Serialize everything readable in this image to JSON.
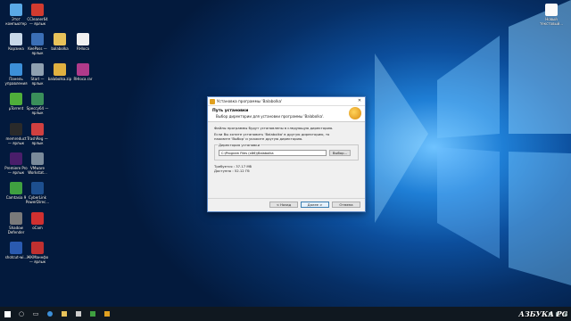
{
  "desktop_icons": [
    {
      "label": "Этот\nкомпьютер",
      "icon": "computer-icon",
      "color": "#5aa9e6"
    },
    {
      "label": "CCleaner64\n— ярлык",
      "icon": "ccleaner-icon",
      "color": "#d23b2f"
    },
    {
      "label": "Корзина",
      "icon": "recycle-bin-icon",
      "color": "#c8d8e8"
    },
    {
      "label": "KeePass —\nярлык",
      "icon": "keepass-icon",
      "color": "#3b6fb6"
    },
    {
      "label": "balabolka",
      "icon": "folder-icon",
      "color": "#e8c25a"
    },
    {
      "label": "RHloca",
      "icon": "file-icon",
      "color": "#f0f0f0"
    },
    {
      "label": "Панель\nуправления",
      "icon": "control-panel-icon",
      "color": "#3c8fd8"
    },
    {
      "label": "Start —\nярлык",
      "icon": "start-icon",
      "color": "#8fa0b0"
    },
    {
      "label": "balabolka.zip",
      "icon": "zip-icon",
      "color": "#e0b040"
    },
    {
      "label": "RHloca.rar",
      "icon": "rar-icon",
      "color": "#b03a8a"
    },
    {
      "label": "µTorrent",
      "icon": "utorrent-icon",
      "color": "#4fae3a"
    },
    {
      "label": "Speccy64 —\nярлык",
      "icon": "speccy-icon",
      "color": "#3a8f5a"
    },
    {
      "label": "memreduct\n— ярлык",
      "icon": "memreduct-icon",
      "color": "#2a2a2a"
    },
    {
      "label": "TrashReg —\nярлык",
      "icon": "trashreg-icon",
      "color": "#d04040"
    },
    {
      "label": "Premiere Pro\n— ярлык",
      "icon": "premiere-icon",
      "color": "#4a1e6a"
    },
    {
      "label": "VMware\nWorkstat...",
      "icon": "vmware-icon",
      "color": "#7a8a9a"
    },
    {
      "label": "Camtasia 9",
      "icon": "camtasia-icon",
      "color": "#3fa040"
    },
    {
      "label": "CyberLink\nPowerDirec...",
      "icon": "powerdirector-icon",
      "color": "#1d4f8f"
    },
    {
      "label": "Shadow\nDefender",
      "icon": "shadow-defender-icon",
      "color": "#7a7a7a"
    },
    {
      "label": "oCam",
      "icon": "ocam-icon",
      "color": "#d03030"
    },
    {
      "label": "shotcut-wi...",
      "icon": "shotcut-icon",
      "color": "#2a5ab0"
    },
    {
      "label": "ЖКМаннфо\n— ярлык",
      "icon": "app-icon",
      "color": "#c03030"
    }
  ],
  "desktop_right_icon": {
    "label": "Новый\nтекстовый...",
    "icon": "text-file-icon"
  },
  "dialog": {
    "title": "Установка программы 'Balabolka'",
    "header_title": "Путь установки",
    "header_subtitle": "Выбор директории для установки программы 'Balabolka'.",
    "line1": "Файлы программы будут установлены в следующую директорию.",
    "line2": "Если Вы хотите установить 'Balabolka' в другую директорию, то",
    "line3": "нажмите 'Выбор' и укажите другую директорию.",
    "group_label": "Директория установки",
    "path_value": "C:\\Program Files (x86)\\Balabolka",
    "browse_label": "Выбор...",
    "required": "Требуется : 37.17 Мб",
    "available": "Доступно : 52.12 Гб",
    "back_label": "< Назад",
    "next_label": "Далее >",
    "cancel_label": "Отмена"
  },
  "watermark": "АЗБУКА РС",
  "colors": {
    "accent": "#1f7fd6",
    "taskbar": "#101820"
  }
}
